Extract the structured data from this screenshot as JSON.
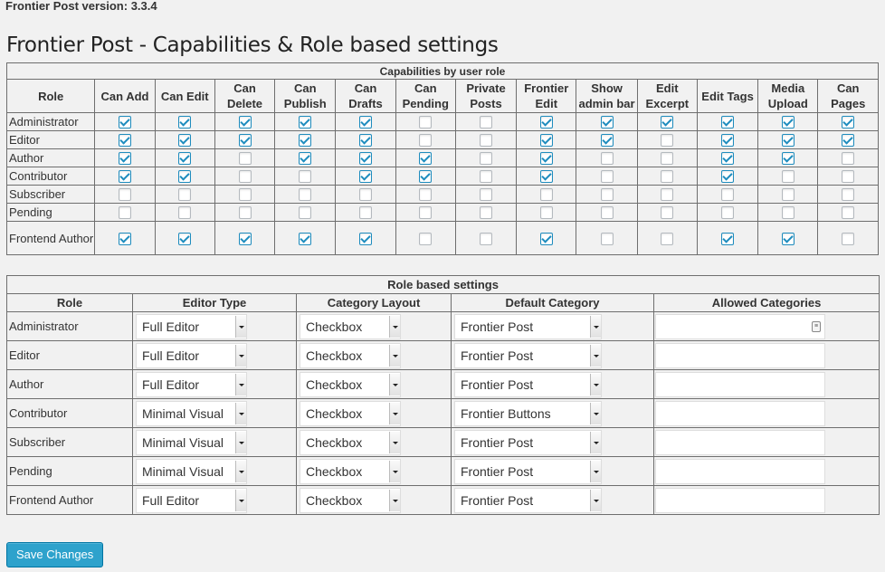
{
  "version": "Frontier Post version: 3.3.4",
  "title": "Frontier Post - Capabilities & Role based settings",
  "capabilities": {
    "title": "Capabilities by user role",
    "columns": [
      "Role",
      "Can Add",
      "Can Edit",
      "Can Delete",
      "Can Publish",
      "Can Drafts",
      "Can Pending",
      "Private Posts",
      "Frontier Edit",
      "Show admin bar",
      "Edit Excerpt",
      "Edit Tags",
      "Media Upload",
      "Can Pages"
    ],
    "rows": [
      {
        "role": "Administrator",
        "values": [
          1,
          1,
          1,
          1,
          1,
          0,
          0,
          1,
          1,
          1,
          1,
          1,
          1
        ]
      },
      {
        "role": "Editor",
        "values": [
          1,
          1,
          1,
          1,
          1,
          0,
          0,
          1,
          1,
          0,
          1,
          1,
          1
        ]
      },
      {
        "role": "Author",
        "values": [
          1,
          1,
          0,
          1,
          1,
          1,
          0,
          1,
          0,
          0,
          1,
          1,
          0
        ]
      },
      {
        "role": "Contributor",
        "values": [
          1,
          1,
          0,
          0,
          1,
          1,
          0,
          1,
          0,
          0,
          1,
          0,
          0
        ]
      },
      {
        "role": "Subscriber",
        "values": [
          0,
          0,
          0,
          0,
          0,
          0,
          0,
          0,
          0,
          0,
          0,
          0,
          0
        ]
      },
      {
        "role": "Pending",
        "values": [
          0,
          0,
          0,
          0,
          0,
          0,
          0,
          0,
          0,
          0,
          0,
          0,
          0
        ]
      },
      {
        "role": "Frontend Author",
        "values": [
          1,
          1,
          1,
          1,
          1,
          0,
          0,
          1,
          0,
          0,
          1,
          1,
          0
        ]
      }
    ]
  },
  "role_settings": {
    "title": "Role based settings",
    "columns": [
      "Role",
      "Editor Type",
      "Category Layout",
      "Default Category",
      "Allowed Categories"
    ],
    "rows": [
      {
        "role": "Administrator",
        "editor": "Full Editor",
        "layout": "Checkbox",
        "category": "Frontier Post"
      },
      {
        "role": "Editor",
        "editor": "Full Editor",
        "layout": "Checkbox",
        "category": "Frontier Post"
      },
      {
        "role": "Author",
        "editor": "Full Editor",
        "layout": "Checkbox",
        "category": "Frontier Post"
      },
      {
        "role": "Contributor",
        "editor": "Minimal Visual",
        "layout": "Checkbox",
        "category": "Frontier Buttons"
      },
      {
        "role": "Subscriber",
        "editor": "Minimal Visual",
        "layout": "Checkbox",
        "category": "Frontier Post"
      },
      {
        "role": "Pending",
        "editor": "Minimal Visual",
        "layout": "Checkbox",
        "category": "Frontier Post"
      },
      {
        "role": "Frontend Author",
        "editor": "Full Editor",
        "layout": "Checkbox",
        "category": "Frontier Post"
      }
    ]
  },
  "save_label": "Save Changes",
  "colors": {
    "accent": "#2ea2cc",
    "checkmark": "#1e8cbe"
  }
}
